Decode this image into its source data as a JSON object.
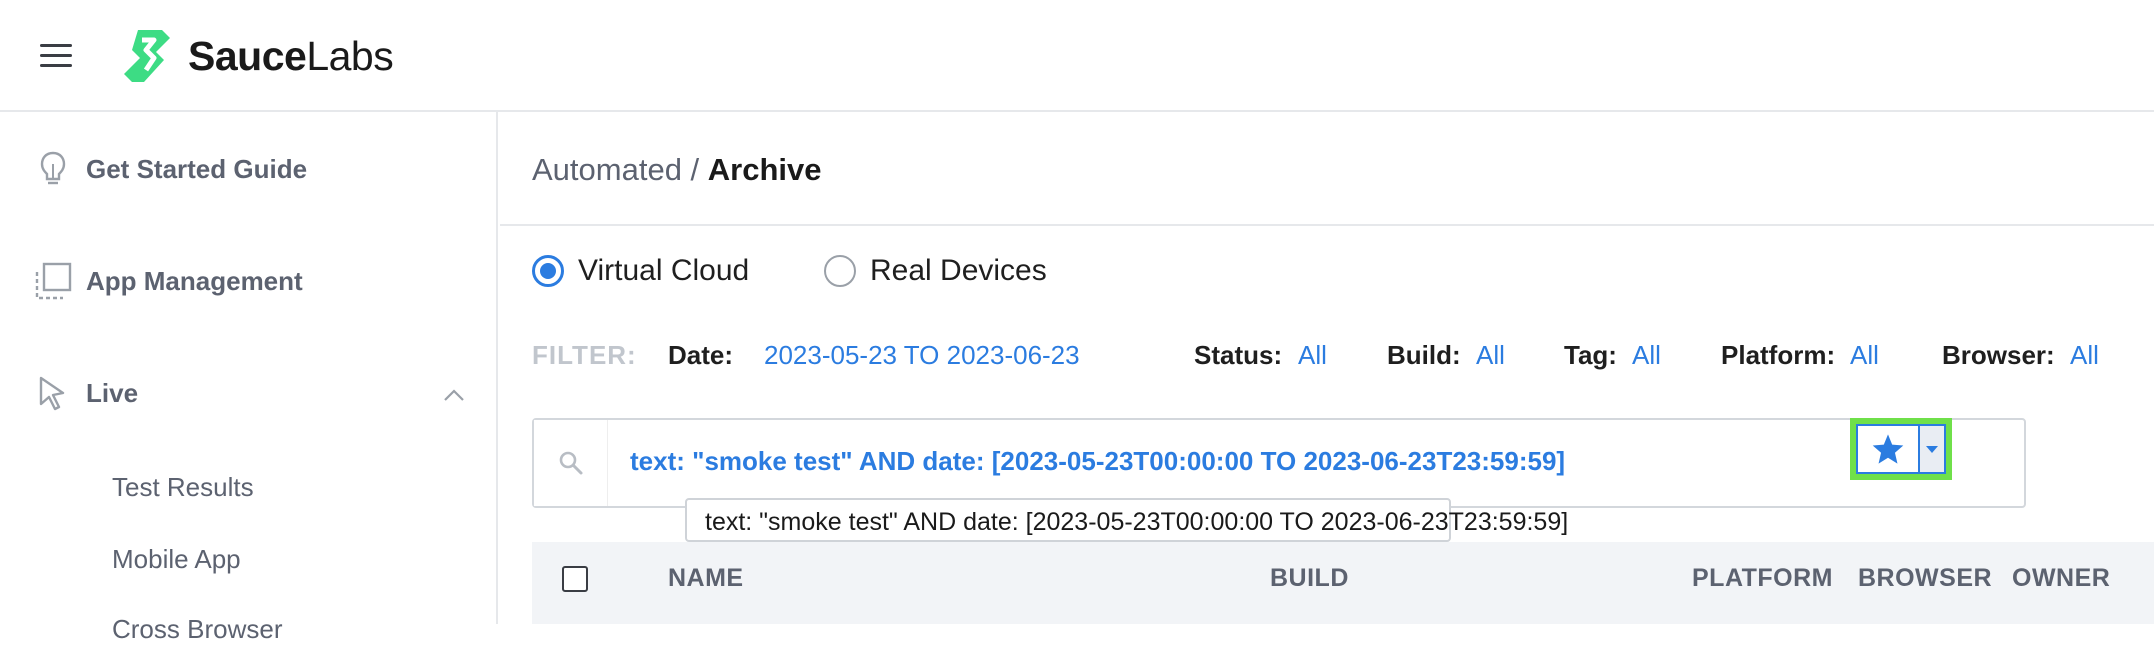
{
  "app": {
    "logo_text_bold": "Sauce",
    "logo_text_light": "Labs",
    "brand_color": "#3ddc84"
  },
  "sidebar": {
    "items": [
      {
        "label": "Get Started Guide",
        "icon": "lightbulb-icon"
      },
      {
        "label": "App Management",
        "icon": "app-management-icon"
      },
      {
        "label": "Live",
        "icon": "cursor-icon"
      }
    ],
    "subitems": [
      "Test Results",
      "Mobile App",
      "Cross Browser"
    ]
  },
  "breadcrumb": {
    "parent": "Automated",
    "separator": " / ",
    "current": "Archive"
  },
  "source": {
    "options": [
      {
        "label": "Virtual Cloud",
        "checked": true
      },
      {
        "label": "Real Devices",
        "checked": false
      }
    ]
  },
  "filter": {
    "title": "FILTER:",
    "date_label": "Date:",
    "date_value": "2023-05-23 TO 2023-06-23",
    "status_label": "Status:",
    "status_value": "All",
    "build_label": "Build:",
    "build_value": "All",
    "tag_label": "Tag:",
    "tag_value": "All",
    "platform_label": "Platform:",
    "platform_value": "All",
    "browser_label": "Browser:",
    "browser_value": "All"
  },
  "search": {
    "query": "text: \"smoke test\" AND date: [2023-05-23T00:00:00 TO 2023-06-23T23:59:59]",
    "tooltip": "text: \"smoke test\" AND date: [2023-05-23T00:00:00 TO 2023-06-23T23:59:59]"
  },
  "table": {
    "columns": [
      "NAME",
      "BUILD",
      "PLATFORM",
      "BROWSER",
      "OWNER"
    ]
  },
  "colors": {
    "accent": "#2b7ce0",
    "highlight": "#6fe04a"
  }
}
